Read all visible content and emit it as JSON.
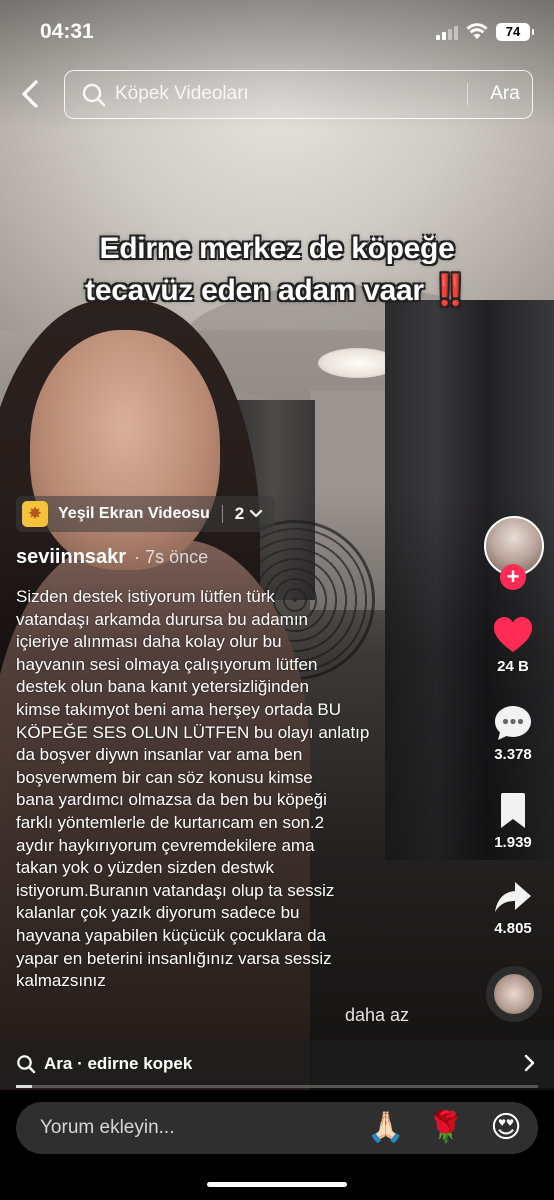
{
  "status_bar": {
    "time": "04:31",
    "battery": "74"
  },
  "search": {
    "placeholder": "Köpek Videoları",
    "button": "Ara"
  },
  "caption": {
    "line1": "Edirne merkez de köpeğe",
    "line2": "tecavüz eden adam vaar",
    "emoji": "‼️"
  },
  "effect": {
    "label": "Yeşil Ekran Videosu",
    "count": "2"
  },
  "post": {
    "author": "seviinnsakr",
    "time": "· 7s önce",
    "description_lines": [
      "Sizden destek istiyorum lütfen türk",
      "vatandaşı arkamda durursa bu adamın",
      "içieriye alınması daha kolay olur bu",
      "hayvanın sesi olmaya çalışıyorum lütfen",
      "destek olun bana kanıt yetersizliğinden",
      "kimse takımyot beni ama herşey ortada BU",
      "KÖPEĞE SES OLUN LÜTFEN bu olayı anlatıp",
      "da boşver diywn insanlar var ama ben",
      "boşverwmem bir can söz konusu kimse",
      "bana yardımcı olmazsa da ben bu köpeği",
      "farklı yöntemlerle de kurtarıcam en son.2",
      "aydır haykırıyorum çevremdekilere ama",
      "takan yok o yüzden sizden destwk",
      "istiyorum.Buranın vatandaşı olup ta sessiz",
      "kalanlar çok yazık diyorum sadece bu",
      "hayvana yapabilen küçücük çocuklara da",
      "yapar en beterini insanlığınız varsa sessiz",
      "kalmazsınız"
    ],
    "less_label": "daha az"
  },
  "actions": {
    "likes": "24 B",
    "comments": "3.378",
    "saves": "1.939",
    "shares": "4.805"
  },
  "icons": {
    "back": "chevron-left-icon",
    "search": "search-icon",
    "like": "heart-icon",
    "comment": "speech-bubble-icon",
    "save": "bookmark-icon",
    "share": "share-arrow-icon"
  },
  "colors": {
    "like": "#fe2c55",
    "follow": "#fe2c55",
    "effect_icon": "#f5c33b"
  },
  "suggestion": {
    "text": "Ara · edirne kopek"
  },
  "video_progress": 0.03,
  "comment_bar": {
    "placeholder": "Yorum ekleyin...",
    "quick_emojis": [
      "🙏🏻",
      "🌹",
      "😍"
    ]
  }
}
